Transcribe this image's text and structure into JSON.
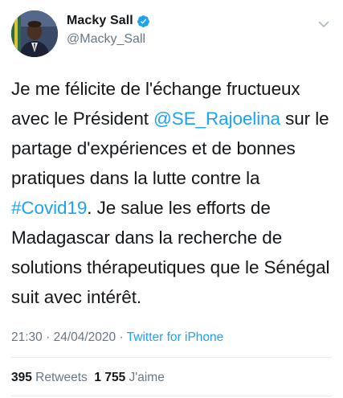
{
  "author": {
    "display_name": "Macky Sall",
    "handle": "@Macky_Sall",
    "verified": true
  },
  "icons": {
    "verified": "verified-badge-icon",
    "menu": "chevron-down-icon"
  },
  "tweet": {
    "segments": [
      {
        "text": "Je me félicite de l'échange fructueux avec le Président ",
        "link": false
      },
      {
        "text": "@SE_Rajoelina",
        "link": true
      },
      {
        "text": " sur le partage d'expériences et de bonnes pratiques dans la lutte contre la ",
        "link": false
      },
      {
        "text": "#Covid19",
        "link": true
      },
      {
        "text": ". Je salue les efforts de Madagascar dans la recherche de solutions thérapeutiques que le Sénégal suit avec intérêt.",
        "link": false
      }
    ]
  },
  "meta": {
    "time": "21:30",
    "separator1": " · ",
    "date": "24/04/2020",
    "separator2": " · ",
    "source": "Twitter for iPhone"
  },
  "stats": {
    "retweets_count": "395",
    "retweets_label": " Retweets",
    "likes_count": "1 755",
    "likes_label": " J'aime"
  },
  "colors": {
    "link": "#1da1f2",
    "secondary_text": "#657786",
    "primary_text": "#14171a",
    "divider": "#e6ecf0"
  }
}
